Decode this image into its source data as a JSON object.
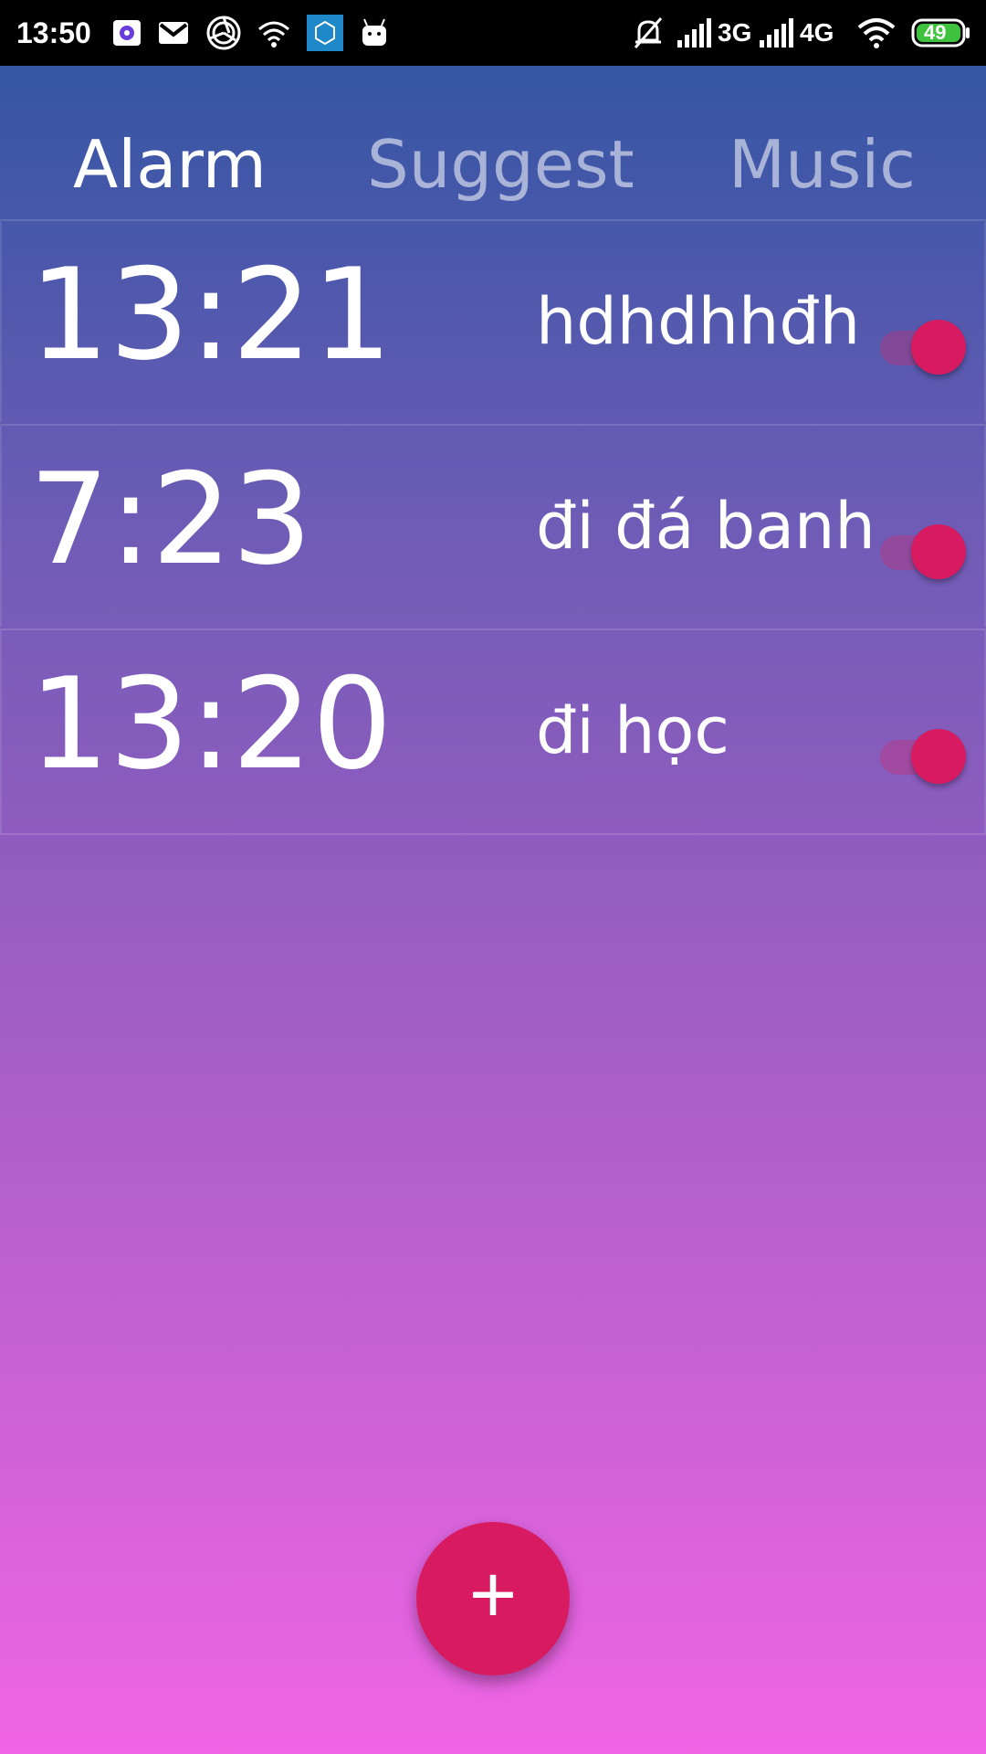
{
  "status_bar": {
    "time": "13:50",
    "network_3g": "3G",
    "network_4g": "4G",
    "battery": "49",
    "icons": [
      "photos-app-icon",
      "gmail-icon",
      "aperture-icon",
      "wifi-link-icon",
      "mi-app-icon",
      "android-icon",
      "silent-bell-icon",
      "signal-icon",
      "signal-icon",
      "wifi-icon",
      "battery-icon"
    ]
  },
  "tabs": [
    {
      "label": "Alarm",
      "active": true
    },
    {
      "label": "Suggest",
      "active": false
    },
    {
      "label": "Music",
      "active": false
    }
  ],
  "alarms": [
    {
      "time": "13:21",
      "label": "hdhdhhđh",
      "enabled": true
    },
    {
      "time": "7:23",
      "label": "đi đá banh",
      "enabled": true
    },
    {
      "time": "13:20",
      "label": "đi học",
      "enabled": true
    }
  ],
  "fab": {
    "icon": "plus-icon",
    "label": "+"
  },
  "colors": {
    "accent": "#d81b60",
    "gradient_top": "#2d55a0",
    "gradient_bottom": "#f064e6"
  }
}
